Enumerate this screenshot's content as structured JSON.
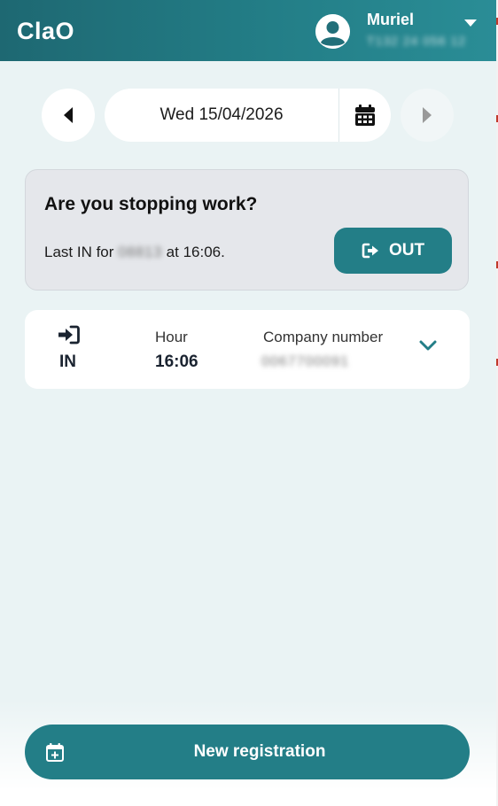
{
  "header": {
    "logo": "ClaO",
    "user_name": "Muriel",
    "user_subtitle": "T132 24 056 12",
    "avatar_icon": "user-circle-icon",
    "menu_icon": "caret-down-icon"
  },
  "date_nav": {
    "date": "Wed 15/04/2026",
    "prev_icon": "caret-left-icon",
    "next_icon": "caret-right-icon",
    "calendar_icon": "calendar-icon"
  },
  "stop_card": {
    "title": "Are you stopping work?",
    "last_in_prefix": "Last IN for",
    "last_in_redacted": "08813",
    "last_in_suffix": "at 16:06.",
    "out_label": "OUT",
    "out_icon": "sign-out-icon"
  },
  "record": {
    "type": "IN",
    "type_icon": "sign-in-icon",
    "hour_header": "Hour",
    "hour": "16:06",
    "company_header": "Company number",
    "company_number": "0067700091",
    "expand_icon": "chevron-down-icon"
  },
  "footer": {
    "new_registration": "New registration",
    "new_icon": "calendar-plus-icon"
  },
  "colors": {
    "accent": "#237e87",
    "background": "#eaf3f4",
    "card": "#ffffff",
    "stop_card": "#e5e7eb"
  }
}
